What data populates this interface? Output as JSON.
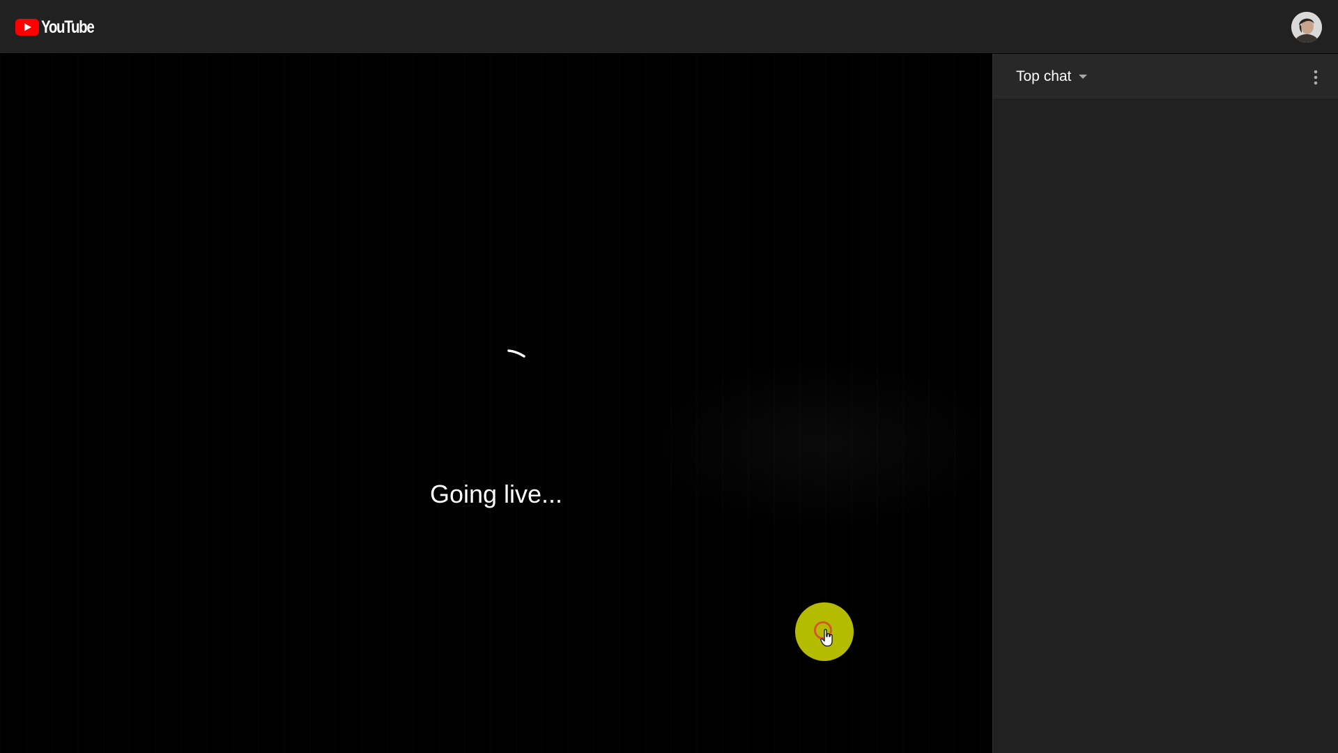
{
  "header": {
    "brand": "YouTube",
    "logo_icon": "youtube-play-icon",
    "avatar_icon": "user-avatar-icon",
    "brand_color": "#ff0000"
  },
  "player": {
    "status_text": "Going live...",
    "spinner_icon": "loading-spinner-icon",
    "cursor_highlight_color": "#b5bc00"
  },
  "chat": {
    "mode_label": "Top chat",
    "mode_dropdown_icon": "chevron-down-icon",
    "more_icon": "more-vertical-icon"
  }
}
